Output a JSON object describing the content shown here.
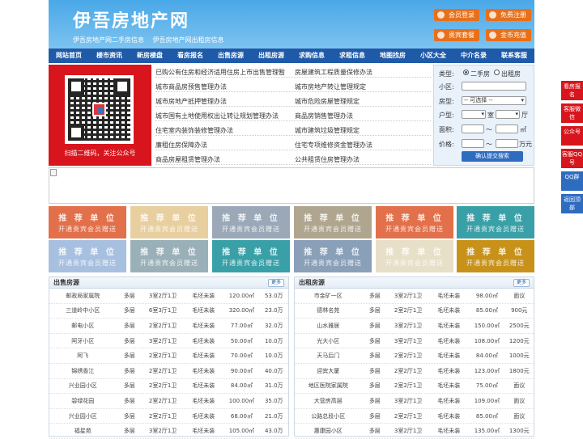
{
  "header": {
    "logo": "伊吾房地产网",
    "sublinks": [
      "伊吾房地产网二手房信息",
      "伊吾房地产网出租房信息"
    ],
    "buttons": [
      "会员登录",
      "免费注册",
      "贵宾套餐",
      "金币充值"
    ]
  },
  "nav": [
    "网站首页",
    "楼市资讯",
    "新房楼盘",
    "看房报名",
    "出售房源",
    "出租房源",
    "求购信息",
    "求租信息",
    "地图找房",
    "小区大全",
    "中介名录",
    "联系客服"
  ],
  "qr": {
    "caption": "扫描二维码，关注公众号"
  },
  "links_left": [
    "已购公有住房和经济适用住房上市出售管理暂",
    "城市商品房预售管理办法",
    "城市房地产抵押管理办法",
    "城市国有土地使用权出让转让规划管理办法",
    "住宅室内装饰装修管理办法",
    "廉租住房保障办法",
    "商品房屋租赁管理办法"
  ],
  "links_right": [
    "房屋建筑工程质量保修办法",
    "城市房地产转让管理规定",
    "城市危险房屋管理规定",
    "商品房销售管理办法",
    "城市建筑垃圾管理规定",
    "住宅专项维修资金管理办法",
    "公共租赁住房管理办法"
  ],
  "search": {
    "type_label": "类型:",
    "opt_sale": "二手房",
    "opt_rent": "出租房",
    "community_label": "小区:",
    "house_type_label": "房型:",
    "house_type_value": "-- 可选择 --",
    "layout_label": "户型:",
    "room_unit": "室",
    "hall_unit": "厅",
    "area_label": "面积:",
    "area_sep": "～",
    "area_unit": "㎡",
    "price_label": "价格:",
    "price_sep": "～",
    "price_unit": "万元",
    "submit": "确认提交搜索"
  },
  "ads": {
    "title": "推 荐 单 位",
    "subtitle": "开通贵宾会员赠送",
    "colors": [
      "#e2704a",
      "#e8cfa0",
      "#9aa8b8",
      "#b0a58f",
      "#e2704a",
      "#3aa0a8",
      "#a8c0e0",
      "#9ab0b8",
      "#3aa0a8",
      "#8aa0b8",
      "#e8dfc8",
      "#c8921a"
    ]
  },
  "sale": {
    "title": "出售房源",
    "more": "更多",
    "rows": [
      [
        "邮政局家属院",
        "多层",
        "3室2厅1卫",
        "毛坯未装",
        "120.00㎡",
        "53.0万"
      ],
      [
        "三道岭中小区",
        "多层",
        "6室3厅1卫",
        "毛坯未装",
        "320.00㎡",
        "23.0万"
      ],
      [
        "邮电小区",
        "多层",
        "2室2厅1卫",
        "毛坯未装",
        "77.00㎡",
        "32.0万"
      ],
      [
        "阿牙小区",
        "多层",
        "3室2厅1卫",
        "毛坯未装",
        "50.00㎡",
        "10.0万"
      ],
      [
        "阿飞",
        "多层",
        "2室2厅1卫",
        "毛坯未装",
        "70.00㎡",
        "10.0万"
      ],
      [
        "锦绣香江",
        "多层",
        "2室2厅1卫",
        "毛坯未装",
        "90.00㎡",
        "40.0万"
      ],
      [
        "兴业园小区",
        "多层",
        "2室2厅1卫",
        "毛坯未装",
        "84.00㎡",
        "31.0万"
      ],
      [
        "碧绿花园",
        "多层",
        "2室2厅1卫",
        "毛坯未装",
        "100.00㎡",
        "35.0万"
      ],
      [
        "兴业园小区",
        "多层",
        "2室2厅1卫",
        "毛坯未装",
        "68.00㎡",
        "21.0万"
      ],
      [
        "福星苑",
        "多层",
        "3室2厅1卫",
        "毛坯未装",
        "105.00㎡",
        "43.0万"
      ]
    ]
  },
  "rent": {
    "title": "出租房源",
    "more": "更多",
    "rows": [
      [
        "市金矿一区",
        "多层",
        "3室2厅1卫",
        "毛坯未装",
        "98.00㎡",
        "面议"
      ],
      [
        "德林名苑",
        "多层",
        "2室2厅1卫",
        "毛坯未装",
        "85.00㎡",
        "900元"
      ],
      [
        "山水雅居",
        "多层",
        "3室2厅1卫",
        "毛坯未装",
        "150.00㎡",
        "2500元"
      ],
      [
        "光大小区",
        "多层",
        "3室2厅1卫",
        "毛坯未装",
        "108.00㎡",
        "1200元"
      ],
      [
        "天马后门",
        "多层",
        "2室2厅1卫",
        "毛坯未装",
        "84.00㎡",
        "1000元"
      ],
      [
        "迎宾大厦",
        "多层",
        "2室2厅1卫",
        "毛坯未装",
        "123.00㎡",
        "1800元"
      ],
      [
        "地区医院家属院",
        "多层",
        "2室2厅1卫",
        "毛坯未装",
        "75.00㎡",
        "面议"
      ],
      [
        "大营房高层",
        "多层",
        "3室2厅1卫",
        "毛坯未装",
        "109.00㎡",
        "面议"
      ],
      [
        "公路总段小区",
        "多层",
        "2室2厅1卫",
        "毛坯未装",
        "85.00㎡",
        "面议"
      ],
      [
        "惠康园小区",
        "多层",
        "3室2厅1卫",
        "毛坯未装",
        "135.00㎡",
        "1300元"
      ]
    ]
  },
  "sidebar": [
    "看房报名",
    "客服微信",
    "公众号",
    "客服QQ号",
    "QQ群",
    "返回顶部"
  ]
}
